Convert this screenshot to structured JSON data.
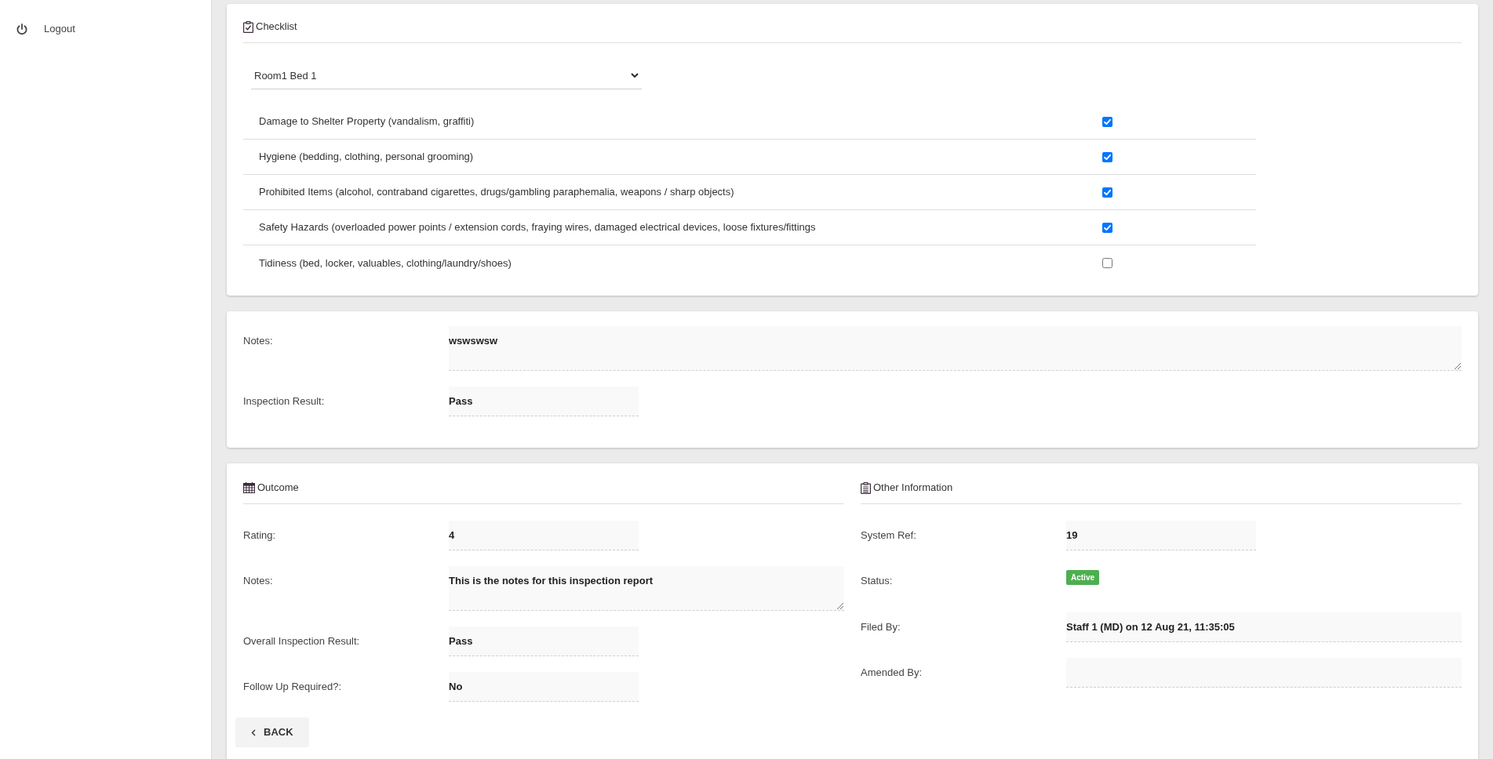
{
  "sidebar": {
    "items": [
      {
        "label": "Logout"
      }
    ]
  },
  "checklist": {
    "title": "Checklist",
    "room_select": {
      "value": "Room1 Bed 1"
    },
    "items": [
      {
        "label": "Damage to Shelter Property (vandalism, graffiti)",
        "checked": true
      },
      {
        "label": "Hygiene (bedding, clothing, personal grooming)",
        "checked": true
      },
      {
        "label": "Prohibited Items (alcohol, contraband cigarettes, drugs/gambling paraphemalia, weapons / sharp objects)",
        "checked": true
      },
      {
        "label": "Safety Hazards (overloaded power points / extension cords, fraying wires, damaged electrical devices, loose fixtures/fittings",
        "checked": true
      },
      {
        "label": "Tidiness (bed, locker, valuables, clothing/laundry/shoes)",
        "checked": false
      }
    ]
  },
  "inspection": {
    "fields": [
      {
        "kind": "textarea",
        "label": "Notes:",
        "value": "wswswsw"
      },
      {
        "kind": "input",
        "label": "Inspection Result:",
        "value": "Pass"
      }
    ]
  },
  "outcome": {
    "title": "Outcome",
    "fields": [
      {
        "kind": "input",
        "label": "Rating:",
        "value": "4"
      },
      {
        "kind": "textarea",
        "label": "Notes:",
        "value": "This is the notes for this inspection report"
      },
      {
        "kind": "input",
        "label": "Overall Inspection Result:",
        "value": "Pass"
      },
      {
        "kind": "input",
        "label": "Follow Up Required?:",
        "value": "No"
      }
    ]
  },
  "other_information": {
    "title": "Other Information",
    "fields": [
      {
        "kind": "input",
        "label": "System Ref:",
        "value": "19"
      },
      {
        "kind": "badge",
        "label": "Status:",
        "value": "Active"
      },
      {
        "kind": "wide",
        "label": "Filed By:",
        "value": "Staff 1 (MD) on 12 Aug 21, 11:35:05"
      },
      {
        "kind": "wide",
        "label": "Amended By:"
      }
    ]
  },
  "back_button": {
    "label": "BACK"
  }
}
